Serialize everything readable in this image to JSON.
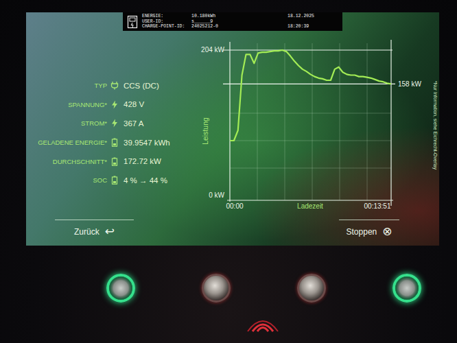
{
  "header": {
    "rows": [
      {
        "label": "ENERGIE:",
        "value": "10.180kWh",
        "right": "18.12.2025"
      },
      {
        "label": "USER-ID:",
        "value": "s______9"
      },
      {
        "label": "CHARGE-POINT-ID:",
        "value": "24025212-0",
        "right": "18:20:39"
      }
    ]
  },
  "info": [
    {
      "label": "TYP",
      "value": "CCS (DC)",
      "kind": "plug"
    },
    {
      "label": "SPANNUNG*",
      "value": "428 V",
      "kind": "bolt"
    },
    {
      "label": "STROM*",
      "value": "367 A",
      "kind": "bolt"
    },
    {
      "label": "GELADENE ENERGIE*",
      "value": "39.9547 kWh",
      "kind": "battery"
    },
    {
      "label": "DURCHSCHNITT*",
      "value": "172.72 kW",
      "kind": "battery"
    },
    {
      "label": "SOC",
      "value": "4 % → 44 %",
      "kind": "battery"
    }
  ],
  "chart": {
    "y_title": "Leistung",
    "y_ticks": [
      "204 kW",
      "0 kW"
    ],
    "current_label": "158 kW",
    "x_title": "Ladezeit",
    "x_start": "00:00",
    "x_end": "00:13:51",
    "series": [
      {
        "values": [
          81,
          81,
          95,
          170,
          198,
          198,
          186,
          200,
          201,
          201,
          202,
          203,
          203,
          204,
          202,
          196,
          189,
          183,
          178,
          175,
          171,
          168,
          166,
          165,
          163,
          163,
          178,
          181,
          174,
          171,
          170,
          170,
          168,
          168,
          167,
          166,
          164,
          162,
          161,
          159,
          158
        ]
      }
    ]
  },
  "note": "*Nur Information, siehe Eichrecht-Overlay",
  "buttons": [
    {
      "label": "Zurück",
      "icon": "↩"
    },
    {
      "label": "Stoppen",
      "icon": "⊗"
    }
  ],
  "hardware_buttons": [
    {
      "lit": true
    },
    {
      "lit": false
    },
    {
      "lit": false
    },
    {
      "lit": true
    }
  ]
}
